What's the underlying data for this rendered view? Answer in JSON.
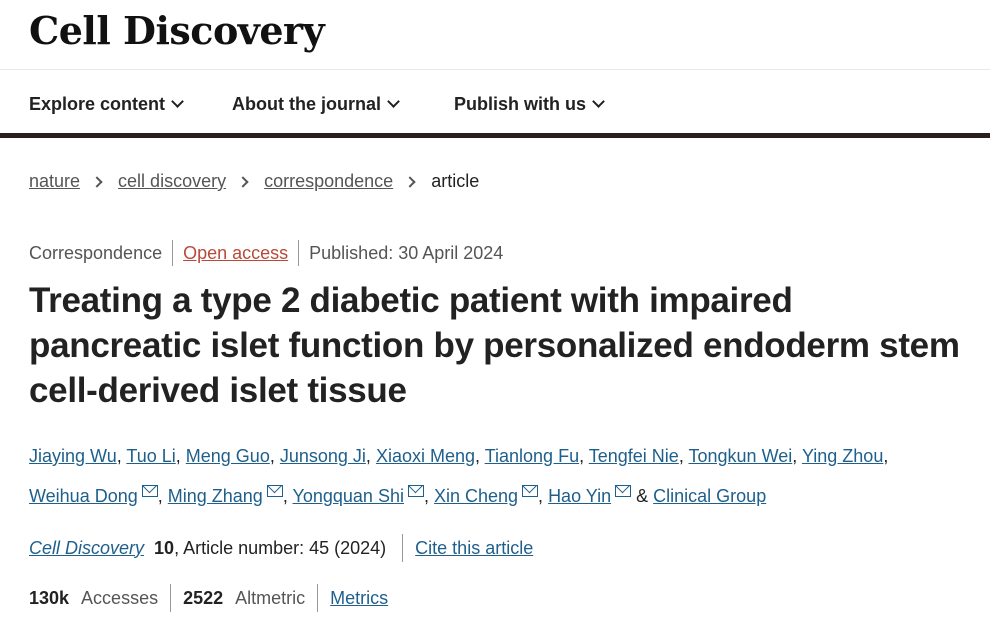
{
  "site": {
    "logo": "Cell Discovery"
  },
  "nav": {
    "items": [
      {
        "label": "Explore content"
      },
      {
        "label": "About the journal"
      },
      {
        "label": "Publish with us"
      }
    ]
  },
  "breadcrumb": {
    "items": [
      "nature",
      "cell discovery",
      "correspondence"
    ],
    "current": "article"
  },
  "meta": {
    "type": "Correspondence",
    "access": "Open access",
    "published": "Published: 30 April 2024"
  },
  "title": "Treating a type 2 diabetic patient with impaired pancreatic islet function by personalized endoderm stem cell-derived islet tissue",
  "authors": {
    "names": [
      "Jiaying Wu",
      "Tuo Li",
      "Meng Guo",
      "Junsong Ji",
      "Xiaoxi Meng",
      "Tianlong Fu",
      "Tengfei Nie",
      "Tongkun Wei",
      "Ying Zhou",
      "Weihua Dong",
      "Ming Zhang",
      "Yongquan Shi",
      "Xin Cheng",
      "Hao Yin"
    ],
    "separator": ", ",
    "amp": "&",
    "group": "Clinical Group"
  },
  "citation": {
    "journal": "Cell Discovery",
    "volume": "10",
    "rest": ", Article number: 45 (2024)",
    "cite_label": "Cite this article"
  },
  "metrics": {
    "accesses": "130k",
    "accesses_label": "Accesses",
    "altmetric": "2522",
    "altmetric_label": "Altmetric",
    "metrics_link": "Metrics"
  },
  "colors": {
    "link": "#1e5f8c",
    "open_access": "#b94a3a",
    "nav_border": "#2b1e1e"
  },
  "icons": {
    "nav_chevron": "chevron-down-icon",
    "breadcrumb_sep": "chevron-right-icon",
    "corresponding": "mail-icon"
  }
}
